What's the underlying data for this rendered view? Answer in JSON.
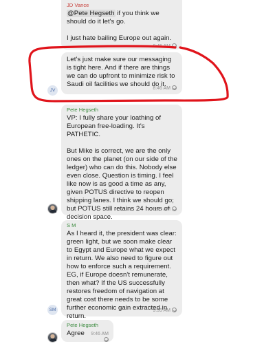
{
  "messages": [
    {
      "sender": "JD Vance",
      "mention": "@Pete Hegseth",
      "text_after_mention": " if you think we should do it let's go.\n\nI just hate bailing Europe out again.",
      "time": "8:45 AM"
    },
    {
      "avatar_initials": "JV",
      "text": "Let's just make sure our messaging is tight here. And if there are things we can do upfront to minimize risk to Saudi oil facilities we should do it.",
      "time": "8:46 AM"
    },
    {
      "sender": "Pete Hegseth",
      "text": "VP: I fully share your loathing of European free-loading. It's PATHETIC.\n\nBut Mike is correct, we are the only ones on the planet (on our side of the ledger) who can do this. Nobody else even close. Question is timing. I feel like now is as good a time as any, given POTUS directive to reopen shipping lanes. I think we should go; but POTUS still retains 24 hours of decision space.",
      "time": "8:49 AM"
    },
    {
      "sender": "S M",
      "avatar_initials": "SM",
      "text": "As I heard it, the president was clear: green light, but we soon make clear to Egypt and Europe what we expect in return. We also need to figure out how to enforce such a requirement. EG, if Europe doesn't remunerate, then what? If the US successfully restores freedom of navigation at great cost there needs to be some further economic gain extracted in return.",
      "time": "9:35 AM"
    },
    {
      "sender": "Pete Hegseth",
      "text": "Agree",
      "time": "9:46 AM"
    }
  ],
  "colors": {
    "bubble": "#ececec",
    "sender_red": "#c8423d",
    "sender_green": "#3b8a3e",
    "annotation": "#e0141b"
  },
  "icons": [
    "read-receipt-icon",
    "user-avatar-photo"
  ]
}
